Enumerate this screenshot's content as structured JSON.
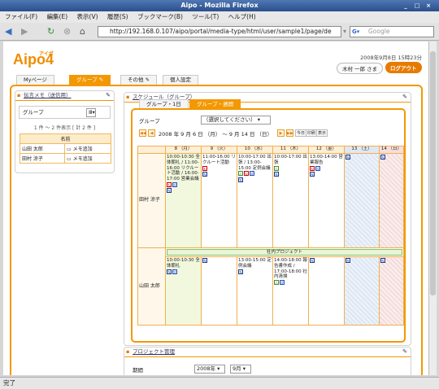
{
  "window": {
    "title": "Aipo - Mozilla Firefox"
  },
  "menu": [
    "ファイル(F)",
    "編集(E)",
    "表示(V)",
    "履歴(S)",
    "ブックマーク(B)",
    "ツール(T)",
    "ヘルプ(H)"
  ],
  "address": {
    "url": "http://192.168.0.107/aipo/portal/media-type/html/user/sample1/page/de"
  },
  "search": {
    "placeholder": "Google"
  },
  "header": {
    "logo_text": "Aipo",
    "logo_ruby": "アイポ",
    "logo_version": "4",
    "datetime": "2008年9月8日 15時23分",
    "user": "木村 一郎 さま",
    "logout": "ログアウト"
  },
  "tabs": [
    "Myページ",
    "グループ",
    "その他",
    "個人設定"
  ],
  "memo": {
    "title": "伝言メモ（送信用）",
    "group_label": "グループ",
    "count": "1 件 ～ 2 件表示 [ 計 2 件 ]",
    "col_name": "名前",
    "rows": [
      {
        "name": "山田 太郎",
        "action": "メモ追加"
      },
      {
        "name": "田村 涼子",
        "action": "メモ追加"
      }
    ]
  },
  "schedule": {
    "title": "スケジュール（グループ）",
    "tab_day": "グループ・1日",
    "tab_week": "グループ・週間",
    "group_label": "グループ",
    "group_select": "（選択してください）",
    "range": "2008 年 9 月 6 日 （月） ～ 9 月 14 日 （日）",
    "btn_today": "今日",
    "btn_print": "印刷",
    "btn_display": "表示",
    "days": [
      "8 （月）",
      "9 （火）",
      "10 （水）",
      "11 （木）",
      "12 （金）",
      "13 （土）",
      "14 （日）"
    ],
    "users": [
      {
        "name": "田村 涼子",
        "cells": [
          "10:00-10:30 全体朝礼 / 11:00-16:00 リクルート活動 / 16:00-17:00 営業会議",
          "11:00-16:00 リクルート活動",
          "10:00-17:00 出張 / 13:00-15:00 定例会議",
          "10:00-17:00 出張",
          "13:00-14:00 営業報告",
          "",
          ""
        ]
      },
      {
        "name": "山田 太郎",
        "project": "社内プロジェクト",
        "cells": [
          "10:00-10:30 全体朝礼",
          "",
          "13:00-15:00 定例会議",
          "14:00-18:00 報告書作成 / 17:00-18:00 社内清掃",
          "",
          "",
          ""
        ]
      }
    ]
  },
  "project": {
    "title": "プロジェクト管理",
    "period_label": "期間",
    "year": "2008年",
    "month": "9月"
  },
  "status": {
    "text": "完了"
  }
}
